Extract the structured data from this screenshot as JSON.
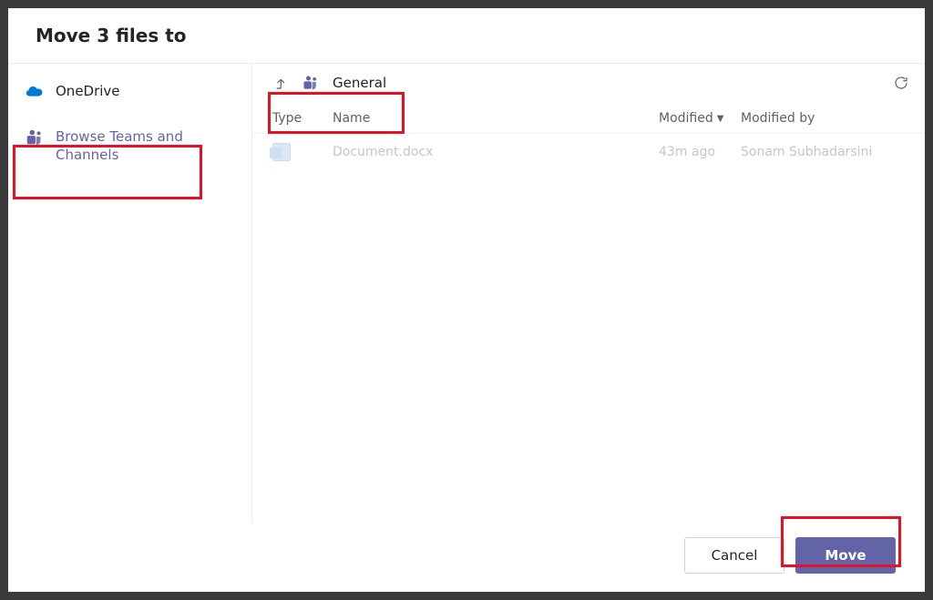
{
  "dialog": {
    "title": "Move 3 files to"
  },
  "sidebar": {
    "items": [
      {
        "label": "OneDrive",
        "icon": "onedrive"
      },
      {
        "label": "Browse Teams and Channels",
        "icon": "teams"
      }
    ]
  },
  "breadcrumb": {
    "label": "General"
  },
  "columns": {
    "type": "Type",
    "name": "Name",
    "modified": "Modified",
    "modifiedby": "Modified by"
  },
  "files": [
    {
      "name": "Document.docx",
      "modified": "43m ago",
      "modifiedby": "Sonam Subhadarsini",
      "type": "word"
    }
  ],
  "footer": {
    "cancel": "Cancel",
    "move": "Move"
  }
}
